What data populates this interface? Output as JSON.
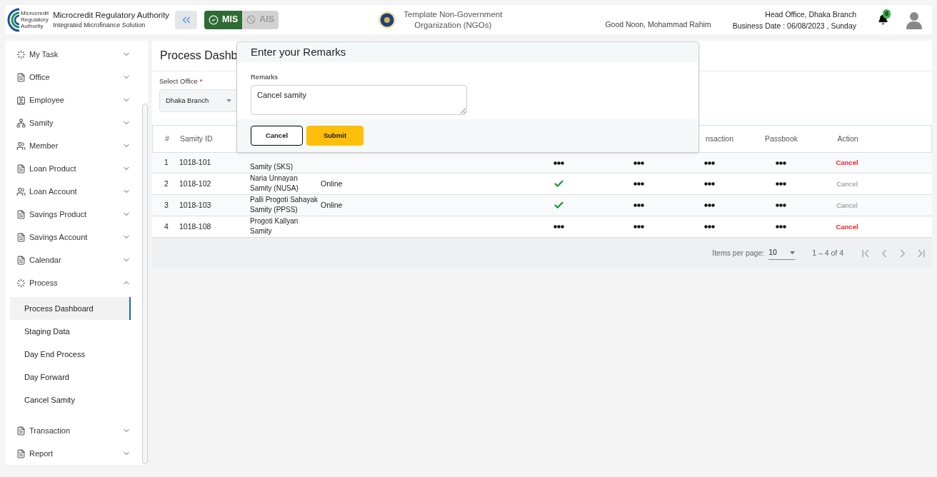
{
  "header": {
    "org_name": "Microcredit Regulatory Authority",
    "org_subtitle": "Integrated Microfinance Solution",
    "logo_text": [
      "Microcredit",
      "Regulatory",
      "Authority"
    ],
    "modules": [
      {
        "label": "MIS",
        "selected": true
      },
      {
        "label": "AIS",
        "selected": false
      }
    ],
    "tenant": [
      "Template Non-Government",
      "Organization (NGOs)"
    ],
    "greeting": "Good Noon, Mohammad Rahim",
    "office": "Head Office, Dhaka Branch",
    "business_date": "Business Date : 06/08/2023 , Sunday",
    "notifications": "8"
  },
  "sidebar": {
    "items": [
      {
        "label": "My Task",
        "kind": "spinner",
        "expanded": false
      },
      {
        "label": "Office",
        "kind": "doc",
        "expanded": false
      },
      {
        "label": "Employee",
        "kind": "id",
        "expanded": false
      },
      {
        "label": "Samity",
        "kind": "network",
        "expanded": false
      },
      {
        "label": "Member",
        "kind": "group",
        "expanded": false
      },
      {
        "label": "Loan Product",
        "kind": "doc",
        "expanded": false
      },
      {
        "label": "Loan Account",
        "kind": "group",
        "expanded": false
      },
      {
        "label": "Savings Product",
        "kind": "doc",
        "expanded": false
      },
      {
        "label": "Savings Account",
        "kind": "doc",
        "expanded": false
      },
      {
        "label": "Calendar",
        "kind": "doc",
        "expanded": false
      },
      {
        "label": "Process",
        "kind": "spinner",
        "expanded": true,
        "children": [
          {
            "label": "Process Dashboard",
            "selected": true
          },
          {
            "label": "Staging Data",
            "selected": false
          },
          {
            "label": "Day End Process",
            "selected": false
          },
          {
            "label": "Day Forward",
            "selected": false
          },
          {
            "label": "Cancel Samity",
            "selected": false
          }
        ]
      },
      {
        "label": "Transaction",
        "kind": "doc",
        "expanded": false
      },
      {
        "label": "Report",
        "kind": "doc",
        "expanded": false
      }
    ]
  },
  "page": {
    "title": "Process Dashb",
    "office_field": {
      "label": "Select Office",
      "required_mark": "*",
      "value": "Dhaka Branch"
    }
  },
  "table": {
    "columns": [
      "#",
      "Samity ID",
      "nsaction",
      "Passbook",
      "Action"
    ],
    "rows": [
      {
        "index": "1",
        "samity_id": "1018-101",
        "name": "Samity (SKS)",
        "kind": "dots",
        "action": {
          "label": "Cancel",
          "enabled": true
        }
      },
      {
        "index": "2",
        "samity_id": "1018-102",
        "name": "Naria Unnayan Samity (NUSA)",
        "mode": "Online",
        "kind": "check",
        "action": {
          "label": "Cancel",
          "enabled": false
        }
      },
      {
        "index": "3",
        "samity_id": "1018-103",
        "name": "Palli Progoti Sahayak Samity (PPSS)",
        "mode": "Online",
        "kind": "check",
        "action": {
          "label": "Cancel",
          "enabled": false
        }
      },
      {
        "index": "4",
        "samity_id": "1018-108",
        "name": "Progoti Kallyan Samity",
        "kind": "dots",
        "action": {
          "label": "Cancel",
          "enabled": true
        }
      }
    ],
    "paginator": {
      "items_per_page_label": "Items per page:",
      "page_size": "10",
      "range": "1 – 4 of 4"
    }
  },
  "modal": {
    "title": "Enter your Remarks",
    "field_label": "Remarks",
    "value": "Cancel samity",
    "buttons": [
      {
        "label": "Cancel",
        "kind": "secondary"
      },
      {
        "label": "Submit",
        "kind": "primary"
      }
    ]
  }
}
